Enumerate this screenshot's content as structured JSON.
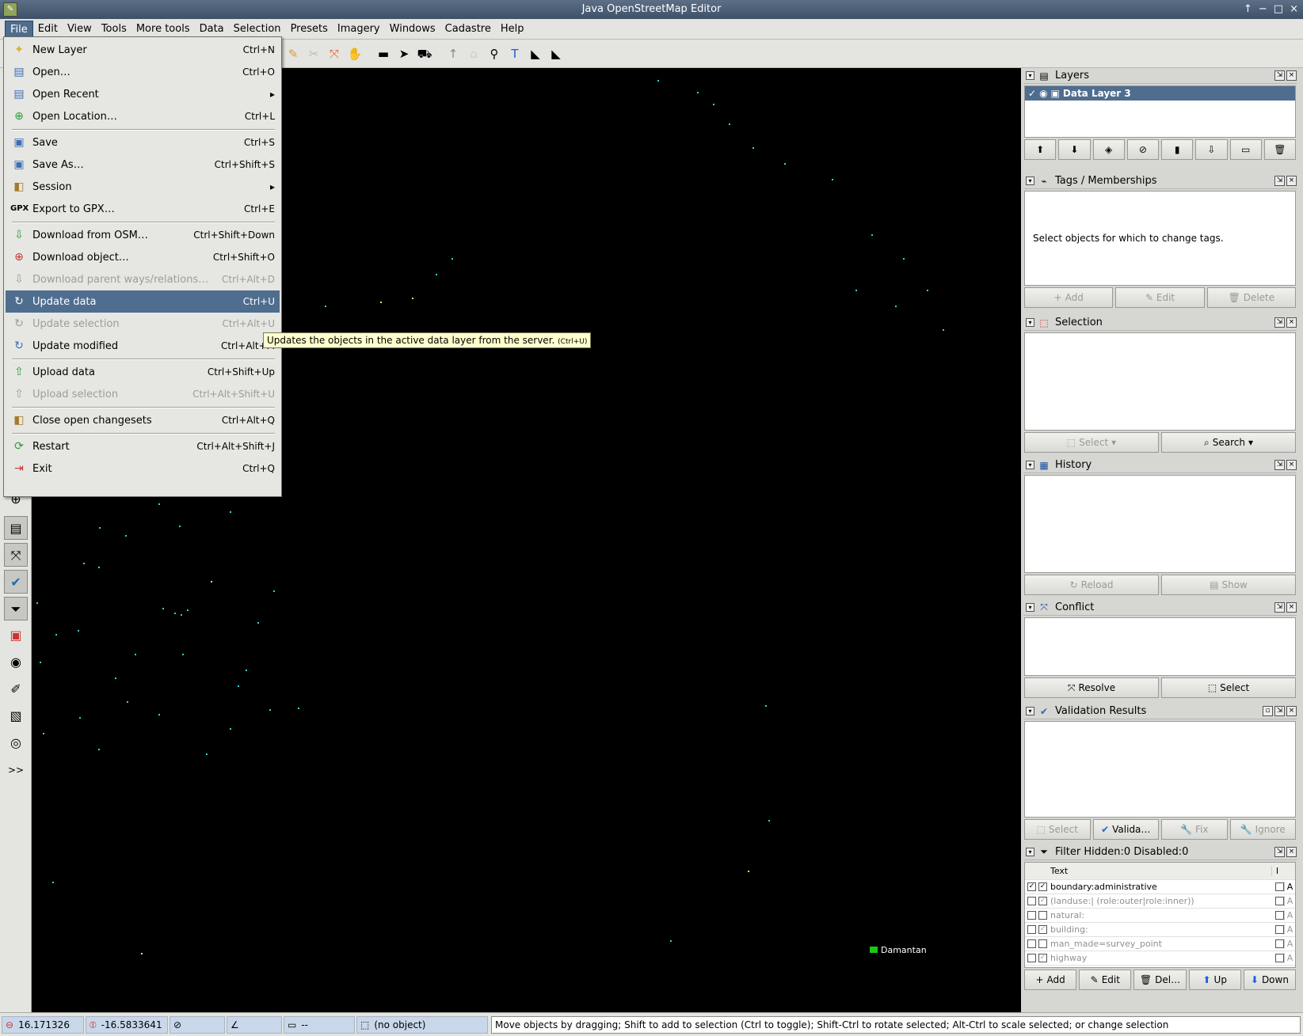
{
  "window": {
    "title": "Java OpenStreetMap Editor",
    "app_icon": "josm-logo-icon",
    "controls": [
      "↑",
      "−",
      "□",
      "×"
    ]
  },
  "menubar": [
    "File",
    "Edit",
    "View",
    "Tools",
    "More tools",
    "Data",
    "Selection",
    "Presets",
    "Imagery",
    "Windows",
    "Cadastre",
    "Help"
  ],
  "file_menu": [
    {
      "label": "New Layer",
      "shortcut": "Ctrl+N",
      "icon": "new-layer-icon",
      "disabled": false
    },
    {
      "label": "Open…",
      "shortcut": "Ctrl+O",
      "icon": "open-icon",
      "disabled": false
    },
    {
      "label": "Open Recent",
      "shortcut": "▸",
      "icon": "open-recent-icon",
      "disabled": false
    },
    {
      "label": "Open Location…",
      "shortcut": "Ctrl+L",
      "icon": "open-location-icon",
      "disabled": false
    },
    {
      "label": "Save",
      "shortcut": "Ctrl+S",
      "icon": "save-icon",
      "disabled": false
    },
    {
      "label": "Save As…",
      "shortcut": "Ctrl+Shift+S",
      "icon": "save-as-icon",
      "disabled": false
    },
    {
      "label": "Session",
      "shortcut": "▸",
      "icon": "session-icon",
      "disabled": false
    },
    {
      "label": "Export to GPX…",
      "shortcut": "Ctrl+E",
      "icon": "gpx-icon",
      "disabled": false
    },
    {
      "label": "Download from OSM…",
      "shortcut": "Ctrl+Shift+Down",
      "icon": "download-icon",
      "disabled": false
    },
    {
      "label": "Download object…",
      "shortcut": "Ctrl+Shift+O",
      "icon": "download-object-icon",
      "disabled": false
    },
    {
      "label": "Download parent ways/relations…",
      "shortcut": "Ctrl+Alt+D",
      "icon": "download-parent-icon",
      "disabled": true
    },
    {
      "label": "Update data",
      "shortcut": "Ctrl+U",
      "icon": "update-data-icon",
      "disabled": false,
      "highlighted": true
    },
    {
      "label": "Update selection",
      "shortcut": "Ctrl+Alt+U",
      "icon": "update-selection-icon",
      "disabled": true
    },
    {
      "label": "Update modified",
      "shortcut": "Ctrl+Alt+M",
      "icon": "update-modified-icon",
      "disabled": false
    },
    {
      "label": "Upload data",
      "shortcut": "Ctrl+Shift+Up",
      "icon": "upload-icon",
      "disabled": false
    },
    {
      "label": "Upload selection",
      "shortcut": "Ctrl+Alt+Shift+U",
      "icon": "upload-selection-icon",
      "disabled": true
    },
    {
      "label": "Close open changesets",
      "shortcut": "Ctrl+Alt+Q",
      "icon": "close-changesets-icon",
      "disabled": false
    },
    {
      "label": "Restart",
      "shortcut": "Ctrl+Alt+Shift+J",
      "icon": "restart-icon",
      "disabled": false
    },
    {
      "label": "Exit",
      "shortcut": "Ctrl+Q",
      "icon": "exit-icon",
      "disabled": false
    }
  ],
  "tooltip": {
    "text": "Updates the objects in the active data layer from the server.",
    "shortcut": "(Ctrl+U)"
  },
  "map": {
    "place_label": "Damantan"
  },
  "panels": {
    "layers": {
      "title": "Layers",
      "active_layer": "Data Layer 3"
    },
    "tags": {
      "title": "Tags / Memberships",
      "empty_text": "Select objects for which to change tags.",
      "buttons": [
        "Add",
        "Edit",
        "Delete"
      ]
    },
    "selection": {
      "title": "Selection",
      "buttons": [
        "Select",
        "Search"
      ]
    },
    "history": {
      "title": "History",
      "buttons": [
        "Reload",
        "Show"
      ]
    },
    "conflict": {
      "title": "Conflict",
      "buttons": [
        "Resolve",
        "Select"
      ]
    },
    "validation": {
      "title": "Validation Results",
      "buttons": [
        "Select",
        "Valida…",
        "Fix",
        "Ignore"
      ]
    },
    "filter": {
      "title": "Filter Hidden:0 Disabled:0",
      "column_text": "Text",
      "column_i": "I",
      "rows": [
        {
          "text": "boundary:administrative",
          "enabled": true,
          "hide": true,
          "dim": false,
          "a": "A"
        },
        {
          "text": "(landuse:| (role:outer|role:inner))",
          "enabled": false,
          "hide": true,
          "dim": true,
          "a": "A"
        },
        {
          "text": "natural:",
          "enabled": false,
          "hide": false,
          "dim": true,
          "a": "A"
        },
        {
          "text": "building:",
          "enabled": false,
          "hide": true,
          "dim": true,
          "a": "A"
        },
        {
          "text": "man_made=survey_point",
          "enabled": false,
          "hide": false,
          "dim": true,
          "a": "A"
        },
        {
          "text": "highway",
          "enabled": false,
          "hide": true,
          "dim": true,
          "a": "A"
        }
      ],
      "buttons": [
        "Add",
        "Edit",
        "Del…",
        "Up",
        "Down"
      ]
    }
  },
  "statusbar": {
    "lat": "16.171326",
    "lon": "-16.5833641",
    "heading": "",
    "angle": "",
    "distance": "--",
    "object": "(no object)",
    "message": "Move objects by dragging; Shift to add to selection (Ctrl to toggle); Shift-Ctrl to rotate selected; Alt-Ctrl to scale selected; or change selection"
  }
}
